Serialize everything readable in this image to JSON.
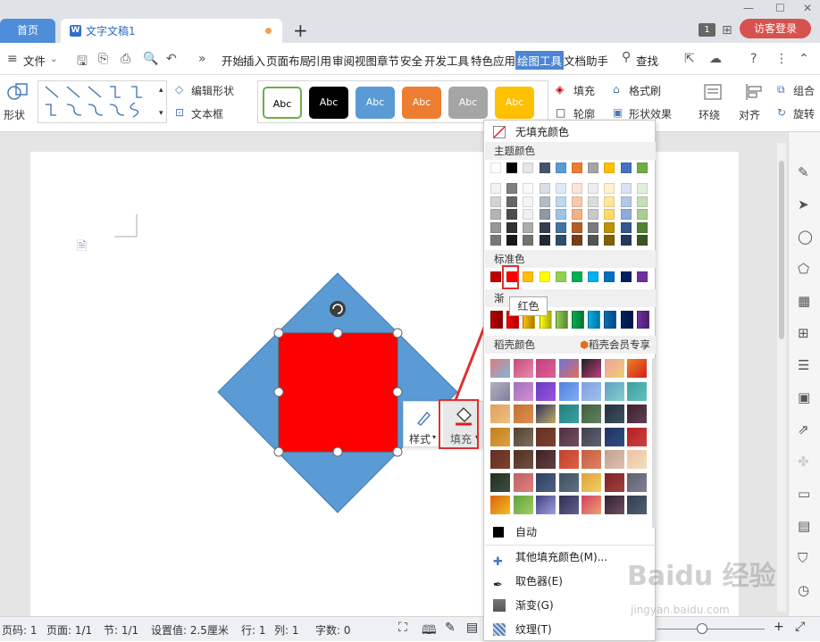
{
  "tabs": {
    "home": "首页",
    "doc": "文字文稿1",
    "badge": "1",
    "visitor": "访客登录"
  },
  "menu": {
    "file": "文件",
    "items": [
      "开始",
      "插入",
      "页面布局",
      "引用",
      "审阅",
      "视图",
      "章节",
      "安全",
      "开发工具",
      "特色应用"
    ],
    "active": "绘图工具",
    "after": "文档助手",
    "search": "查找"
  },
  "ribbon": {
    "shape": "形状",
    "edit_shape": "编辑形状",
    "textbox": "文本框",
    "swatch_text": "Abc",
    "fill": "填充",
    "format_brush": "格式刷",
    "outline": "轮廓",
    "shape_effect": "形状效果",
    "wrap": "环绕",
    "align": "对齐",
    "group": "组合",
    "rotate": "旋转"
  },
  "float_tools": {
    "style": "样式",
    "fill": "填充"
  },
  "picker": {
    "no_fill": "无填充颜色",
    "theme": "主题颜色",
    "standard": "标准色",
    "gradient_partial": "渐",
    "daoke": "稻壳颜色",
    "member": "稻壳会员专享",
    "auto": "自动",
    "more": "其他填充颜色(M)...",
    "eyedropper": "取色器(E)",
    "gradient": "渐变(G)",
    "texture": "纹理(T)",
    "tooltip": "红色"
  },
  "colors": {
    "theme_top": [
      "#ffffff",
      "#000000",
      "#e7e6e6",
      "#44546a",
      "#5b9bd5",
      "#ed7d31",
      "#a5a5a5",
      "#ffc000",
      "#4472c4",
      "#70ad47"
    ],
    "standard": [
      "#c00000",
      "#ff0000",
      "#ffc000",
      "#ffff00",
      "#92d050",
      "#00b050",
      "#00b0f0",
      "#0070c0",
      "#002060",
      "#7030a0"
    ],
    "shape_fill": "#ff0000",
    "diamond": "#5b9bd5",
    "accent": "#4d86d4"
  },
  "status": {
    "page_num": "页码: 1",
    "pages": "页面: 1/1",
    "section": "节: 1/1",
    "setting": "设置值: 2.5厘米",
    "row": "行: 1",
    "col": "列: 1",
    "words": "字数: 0"
  },
  "watermark": {
    "main": "Baidu 经验",
    "sub": "jingyan.baidu.com"
  }
}
